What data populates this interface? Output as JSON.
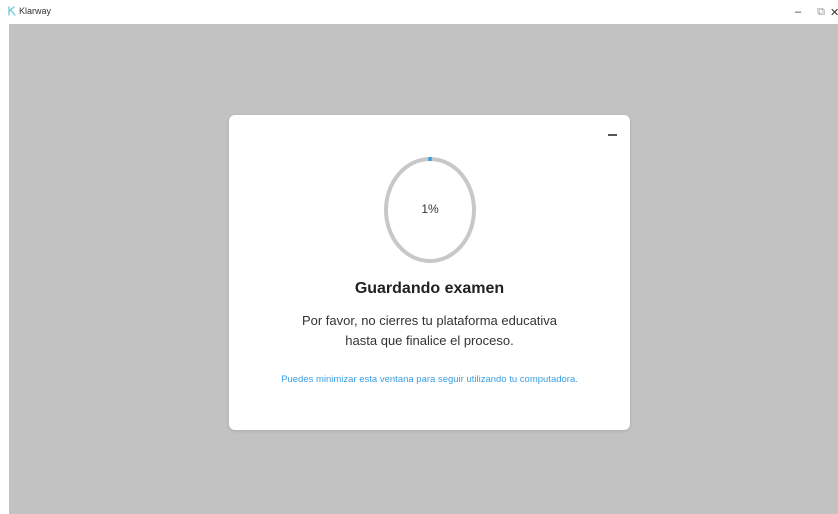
{
  "window": {
    "app_name": "Klarway",
    "minimize_glyph": "–",
    "maximize_glyph": "⧉",
    "close_glyph": "✕"
  },
  "dialog": {
    "progress": {
      "percent": 1,
      "label": "1%"
    },
    "title": "Guardando examen",
    "message_line1": "Por favor, no cierres tu plataforma educativa",
    "message_line2": "hasta que finalice el proceso.",
    "hint": "Puedes minimizar esta ventana para seguir utilizando tu computadora."
  },
  "colors": {
    "accent": "#3a9ee4",
    "overlay_gray": "#c2c2c2",
    "ring_track": "#c8c8c8",
    "logo": "#6cc5d8"
  }
}
